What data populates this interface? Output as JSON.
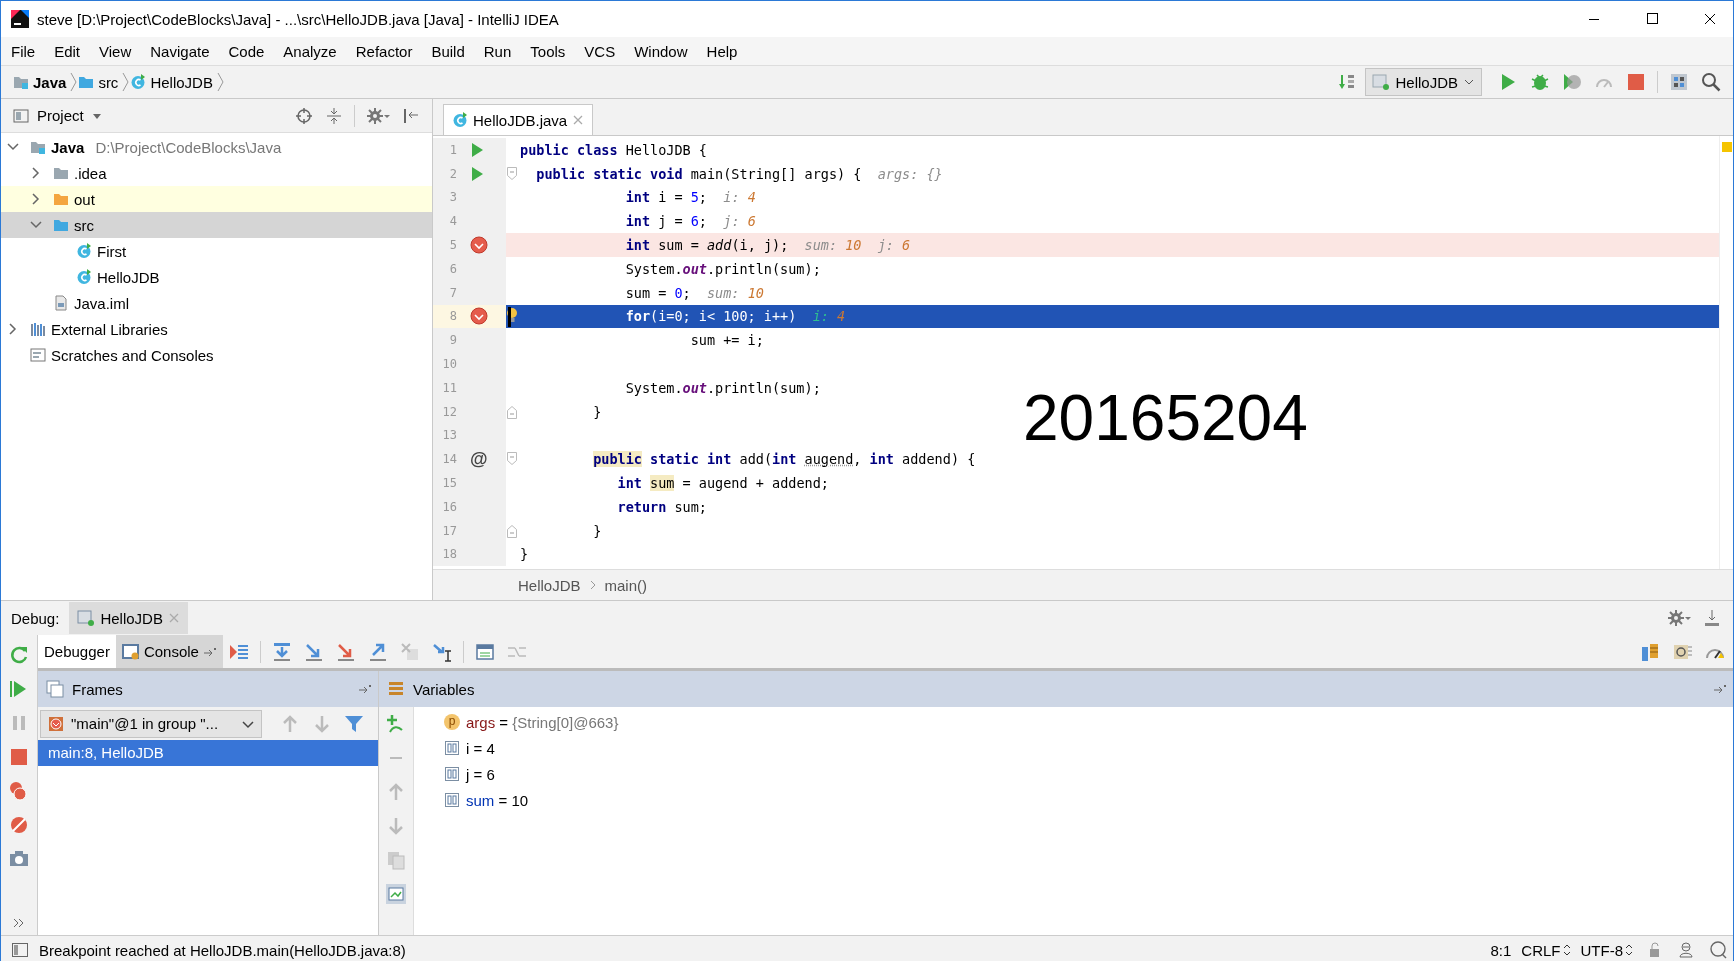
{
  "window": {
    "title": "steve [D:\\Project\\CodeBlocks\\Java] - ...\\src\\HelloJDB.java [Java] - IntelliJ IDEA"
  },
  "menu": [
    "File",
    "Edit",
    "View",
    "Navigate",
    "Code",
    "Analyze",
    "Refactor",
    "Build",
    "Run",
    "Tools",
    "VCS",
    "Window",
    "Help"
  ],
  "navigation_bar": {
    "crumbs": [
      {
        "label": "Java",
        "kind": "module"
      },
      {
        "label": "src",
        "kind": "source-folder"
      },
      {
        "label": "HelloJDB",
        "kind": "class"
      }
    ],
    "run_configuration": "HelloJDB"
  },
  "project_panel": {
    "title": "Project",
    "tree": [
      {
        "label": "Java",
        "kind": "module",
        "path": "D:\\Project\\CodeBlocks\\Java",
        "expanded": true,
        "selected": false,
        "children": [
          {
            "label": ".idea",
            "kind": "folder",
            "expanded": false,
            "selected": false
          },
          {
            "label": "out",
            "kind": "excluded-folder",
            "expanded": false,
            "selected": false
          },
          {
            "label": "src",
            "kind": "source-folder",
            "expanded": true,
            "selected": true,
            "children": [
              {
                "label": "First",
                "kind": "class",
                "selected": false
              },
              {
                "label": "HelloJDB",
                "kind": "class",
                "selected": false
              }
            ]
          },
          {
            "label": "Java.iml",
            "kind": "file",
            "selected": false
          }
        ]
      },
      {
        "label": "External Libraries",
        "kind": "libraries",
        "expanded": false,
        "selected": false
      },
      {
        "label": "Scratches and Consoles",
        "kind": "scratches",
        "selected": false
      }
    ]
  },
  "editor": {
    "tabs": [
      {
        "label": "HelloJDB.java",
        "selected": true
      }
    ],
    "lines": [
      {
        "number": "1",
        "kind": "run",
        "tokens": [
          {
            "kind": "kw",
            "text": "public class"
          },
          {
            "kind": "text",
            "text": " HelloJDB {"
          }
        ]
      },
      {
        "number": "2",
        "kind": "run",
        "fold_start": true,
        "tokens": [
          {
            "kind": "kw",
            "text": "  public static void"
          },
          {
            "kind": "text",
            "text": " main(String[] args) {  "
          },
          {
            "kind": "hint",
            "text": "args: {}"
          }
        ]
      },
      {
        "number": "3",
        "tokens": [
          {
            "kind": "kw",
            "text": "             int"
          },
          {
            "kind": "text",
            "text": " i = "
          },
          {
            "kind": "num",
            "text": "5"
          },
          {
            "kind": "text",
            "text": ";  "
          },
          {
            "kind": "hint",
            "text": "i: "
          },
          {
            "kind": "hint_value",
            "text": "4"
          }
        ]
      },
      {
        "number": "4",
        "tokens": [
          {
            "kind": "kw",
            "text": "             int"
          },
          {
            "kind": "text",
            "text": " j = "
          },
          {
            "kind": "num",
            "text": "6"
          },
          {
            "kind": "text",
            "text": ";  "
          },
          {
            "kind": "hint",
            "text": "j: "
          },
          {
            "kind": "hint_value",
            "text": "6"
          }
        ]
      },
      {
        "number": "5",
        "kind": "breakpoint",
        "tokens": [
          {
            "kind": "kw",
            "text": "             int"
          },
          {
            "kind": "text",
            "text": " sum = "
          },
          {
            "kind": "italic",
            "text": "add"
          },
          {
            "kind": "text",
            "text": "(i, j);  "
          },
          {
            "kind": "hint",
            "text": "sum: "
          },
          {
            "kind": "hint_value",
            "text": "10"
          },
          {
            "kind": "hint",
            "text": "  j: "
          },
          {
            "kind": "hint_value",
            "text": "6"
          }
        ]
      },
      {
        "number": "6",
        "tokens": [
          {
            "kind": "text",
            "text": "             System."
          },
          {
            "kind": "field",
            "text": "out"
          },
          {
            "kind": "text",
            "text": ".println(sum);"
          }
        ]
      },
      {
        "number": "7",
        "tokens": [
          {
            "kind": "text",
            "text": "             sum = "
          },
          {
            "kind": "num",
            "text": "0"
          },
          {
            "kind": "text",
            "text": ";  "
          },
          {
            "kind": "hint",
            "text": "sum: "
          },
          {
            "kind": "hint_value",
            "text": "10"
          }
        ]
      },
      {
        "number": "8",
        "kind": "execution",
        "intention": true,
        "tokens": [
          {
            "kind": "kw",
            "text": "             for"
          },
          {
            "kind": "text",
            "text": "(i=0; i< 100; i++)  "
          },
          {
            "kind": "hint",
            "text": "i: "
          },
          {
            "kind": "hint_value",
            "text": "4"
          }
        ]
      },
      {
        "number": "9",
        "tokens": [
          {
            "kind": "text",
            "text": "                     sum += i;"
          }
        ]
      },
      {
        "number": "10"
      },
      {
        "number": "11",
        "tokens": [
          {
            "kind": "text",
            "text": "             System."
          },
          {
            "kind": "field",
            "text": "out"
          },
          {
            "kind": "text",
            "text": ".println(sum);"
          }
        ]
      },
      {
        "number": "12",
        "fold_end": true,
        "tokens": [
          {
            "kind": "text",
            "text": "         }"
          }
        ]
      },
      {
        "number": "13"
      },
      {
        "number": "14",
        "marker": "@",
        "fold_start": true,
        "tokens": [
          {
            "kind": "kw",
            "text": "         public",
            "usage": true
          },
          {
            "kind": "kw",
            "text": " static int"
          },
          {
            "kind": "text",
            "text": " add("
          },
          {
            "kind": "kw",
            "text": "int "
          },
          {
            "kind": "text",
            "text": "augend",
            "weak": true
          },
          {
            "kind": "text",
            "text": ", "
          },
          {
            "kind": "kw",
            "text": "int"
          },
          {
            "kind": "text",
            "text": " addend) {"
          }
        ]
      },
      {
        "number": "15",
        "tokens": [
          {
            "kind": "kw",
            "text": "            int "
          },
          {
            "kind": "text",
            "text": "sum",
            "usage": true
          },
          {
            "kind": "text",
            "text": " = augend + addend;"
          }
        ]
      },
      {
        "number": "16",
        "tokens": [
          {
            "kind": "kw",
            "text": "            return"
          },
          {
            "kind": "text",
            "text": " sum;"
          }
        ]
      },
      {
        "number": "17",
        "fold_end": true,
        "tokens": [
          {
            "kind": "text",
            "text": "         }"
          }
        ]
      },
      {
        "number": "18",
        "tokens": [
          {
            "kind": "text",
            "text": "}"
          }
        ]
      }
    ],
    "overlay_text": "20165204",
    "breadcrumbs": [
      "HelloJDB",
      "main()"
    ]
  },
  "debug": {
    "label": "Debug:",
    "session_tabs": [
      {
        "label": "HelloJDB",
        "selected": true
      }
    ],
    "view_tabs": [
      {
        "label": "Debugger",
        "selected": true
      },
      {
        "label": "Console",
        "selected": false
      }
    ],
    "frames": {
      "title": "Frames",
      "thread": "\"main\"@1 in group \"...",
      "items": [
        {
          "label": "main:8, HelloJDB",
          "selected": true
        }
      ]
    },
    "variables": {
      "title": "Variables",
      "items": [
        {
          "kind": "parameter",
          "badge": "p",
          "name": "args",
          "operator": "=",
          "value": "{String[0]@663}",
          "changed": false
        },
        {
          "kind": "primitive",
          "name": "i",
          "operator": "=",
          "value": "4",
          "changed": false
        },
        {
          "kind": "primitive",
          "name": "j",
          "operator": "=",
          "value": "6",
          "changed": false
        },
        {
          "kind": "primitive",
          "name": "sum",
          "operator": "=",
          "value": "10",
          "changed": true
        }
      ]
    }
  },
  "status_bar": {
    "message": "Breakpoint reached at HelloJDB.main(HelloJDB.java:8)",
    "position": "8:1",
    "line_separator": "CRLF",
    "encoding": "UTF-8"
  }
}
